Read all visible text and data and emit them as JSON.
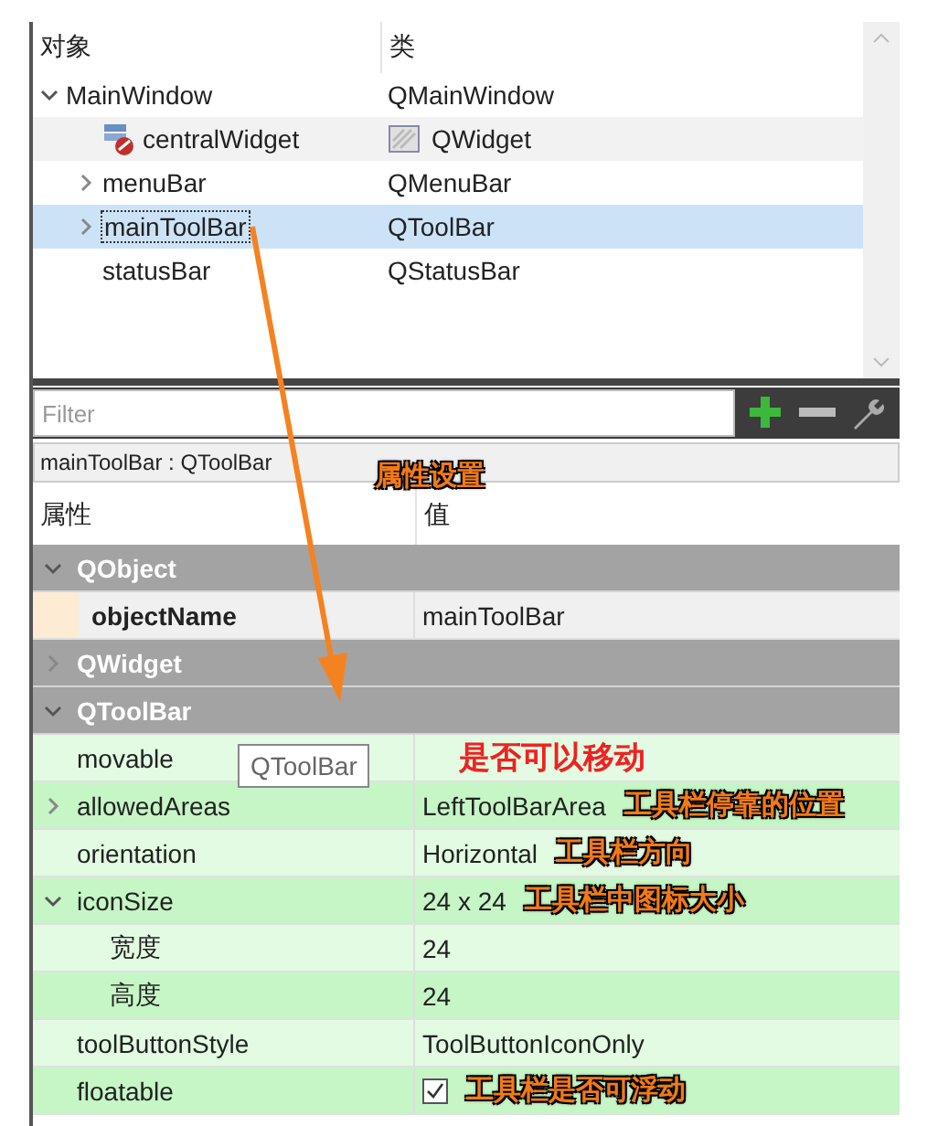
{
  "object_tree": {
    "columns": [
      "对象",
      "类"
    ],
    "rows": [
      {
        "name": "MainWindow",
        "class": "QMainWindow",
        "expanded": true,
        "selected": false,
        "children": [
          {
            "name": "centralWidget",
            "class": "QWidget",
            "kind": "widget",
            "selected": false
          },
          {
            "name": "menuBar",
            "class": "QMenuBar",
            "expanded": false,
            "selected": false
          },
          {
            "name": "mainToolBar",
            "class": "QToolBar",
            "expanded": false,
            "selected": true
          },
          {
            "name": "statusBar",
            "class": "QStatusBar",
            "selected": false
          }
        ]
      }
    ]
  },
  "filter": {
    "placeholder": "Filter"
  },
  "breadcrumb": "mainToolBar : QToolBar",
  "property_editor": {
    "columns": [
      "属性",
      "值"
    ],
    "note": "属性设置",
    "groups": [
      {
        "name": "QObject",
        "expanded": true,
        "properties": [
          {
            "name": "objectName",
            "value": "mainToolBar",
            "changed": true
          }
        ]
      },
      {
        "name": "QWidget",
        "expanded": false
      },
      {
        "name": "QToolBar",
        "expanded": true,
        "properties": [
          {
            "name": "movable",
            "changed": false,
            "note": {
              "text": "是否可以移动",
              "kind": "emphasis"
            }
          },
          {
            "name": "allowedAreas",
            "value": "LeftToolBarArea",
            "changed": false,
            "expanded": false,
            "note": {
              "text": "工具栏停靠的位置",
              "kind": "label"
            }
          },
          {
            "name": "orientation",
            "value": "Horizontal",
            "changed": false,
            "note": {
              "text": "工具栏方向",
              "kind": "label"
            }
          },
          {
            "name": "iconSize",
            "value": "24 x 24",
            "changed": false,
            "expanded": true,
            "note": {
              "text": "工具栏中图标大小",
              "kind": "label"
            },
            "children": [
              {
                "name": "宽度",
                "value": "24",
                "changed": false
              },
              {
                "name": "高度",
                "value": "24",
                "changed": false
              }
            ]
          },
          {
            "name": "toolButtonStyle",
            "value": "ToolButtonIconOnly",
            "changed": false
          },
          {
            "name": "floatable",
            "kind": "checkbox",
            "checked": true,
            "changed": false,
            "note": {
              "text": "工具栏是否可浮动",
              "kind": "label"
            }
          }
        ]
      }
    ]
  },
  "tooltip": "QToolBar"
}
